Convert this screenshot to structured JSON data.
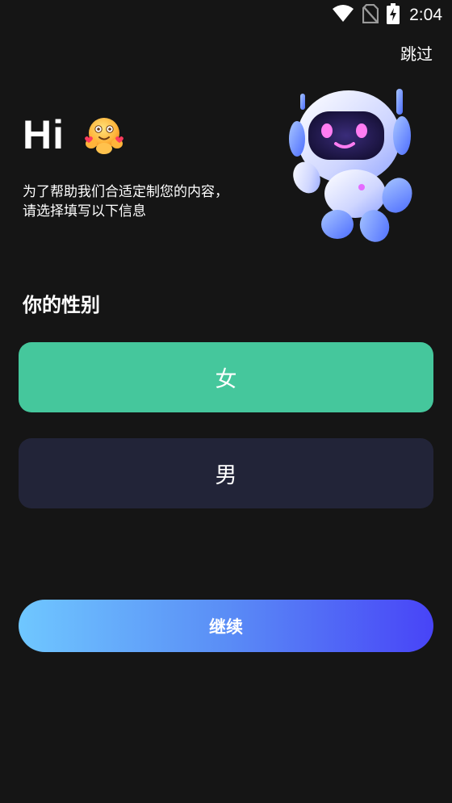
{
  "status_bar": {
    "time": "2:04",
    "icons": [
      "wifi-icon",
      "no-sim-icon",
      "battery-charging-icon"
    ]
  },
  "header": {
    "skip_label": "跳过"
  },
  "greeting": {
    "title": "Hi",
    "emoji": "hugging-face-with-hearts",
    "intro_line1": "为了帮助我们合适定制您的内容，",
    "intro_line2": "请选择填写以下信息"
  },
  "gender": {
    "title": "你的性别",
    "options": [
      {
        "label": "女",
        "selected": true,
        "color": "#45c79c"
      },
      {
        "label": "男",
        "selected": false,
        "color": "#222438"
      }
    ]
  },
  "footer": {
    "continue_label": "继续",
    "gradient_start": "#6fc7ff",
    "gradient_end": "#4844f7"
  },
  "colors": {
    "background": "#151515",
    "accent": "#45c79c"
  }
}
